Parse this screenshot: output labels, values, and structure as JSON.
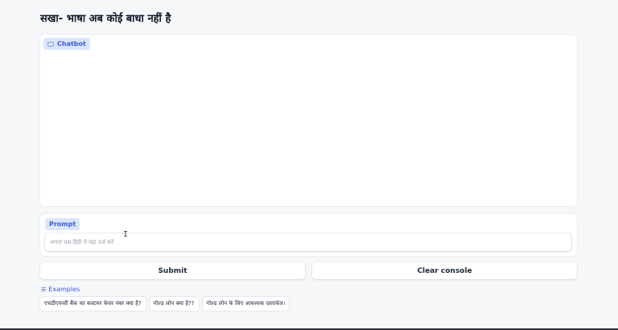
{
  "page": {
    "title": "सखा- भाषा अब कोई बाधा नहीं है"
  },
  "chatbot": {
    "label": "Chatbot",
    "icon": "chat-icon"
  },
  "prompt": {
    "label": "Prompt",
    "placeholder": "अपना प्रश्न हिंदी में यहां दर्ज करें",
    "value": ""
  },
  "buttons": {
    "submit_label": "Submit",
    "clear_label": "Clear console"
  },
  "examples": {
    "label": "Examples",
    "items": [
      "एचडीएफसी बैंक का कस्टमर केयर नंबर क्या है?",
      "गोल्ड लोन क्या है??",
      "गोल्ड लोन के लिए आवश्यक दस्तावेज।"
    ]
  },
  "colors": {
    "accent": "#3b5bdb",
    "chip_bg": "#dbe6fb",
    "page_bg": "#f6f7f9"
  }
}
